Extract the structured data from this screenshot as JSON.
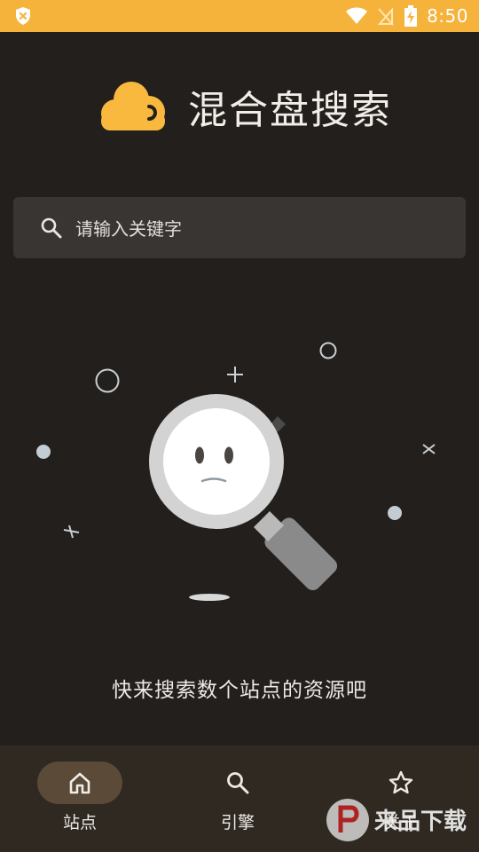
{
  "status_bar": {
    "time": "8:50",
    "icons": [
      "shield-x-icon",
      "wifi-icon",
      "no-signal-icon",
      "battery-charging-icon"
    ],
    "background": "#f5b33b"
  },
  "header": {
    "title": "混合盘搜索",
    "logo_icon": "cloud-logo-icon",
    "accent": "#f9b93f"
  },
  "search": {
    "placeholder": "请输入关键字",
    "value": ""
  },
  "empty_state": {
    "illustration_icon": "magnifier-sad-face-icon",
    "message": "快来搜索数个站点的资源吧"
  },
  "bottom_nav": {
    "items": [
      {
        "label": "站点",
        "icon": "home-icon",
        "active": true
      },
      {
        "label": "引擎",
        "icon": "search-icon",
        "active": false
      },
      {
        "label": "关于",
        "icon": "star-icon",
        "active": false
      }
    ]
  },
  "watermark": {
    "text": "来品下载"
  }
}
